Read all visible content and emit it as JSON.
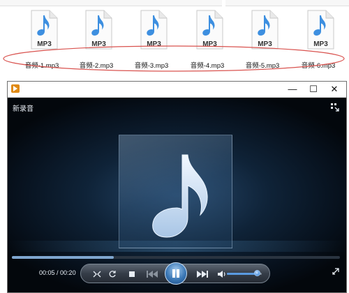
{
  "explorer": {
    "files": [
      {
        "icon": "mp3-file-icon",
        "badge": "MP3",
        "name": "音频-1.mp3"
      },
      {
        "icon": "mp3-file-icon",
        "badge": "MP3",
        "name": "音频-2.mp3"
      },
      {
        "icon": "mp3-file-icon",
        "badge": "MP3",
        "name": "音频-3.mp3"
      },
      {
        "icon": "mp3-file-icon",
        "badge": "MP3",
        "name": "音频-4.mp3"
      },
      {
        "icon": "mp3-file-icon",
        "badge": "MP3",
        "name": "音频-5.mp3"
      },
      {
        "icon": "mp3-file-icon",
        "badge": "MP3",
        "name": "音频-6.mp3"
      }
    ],
    "selection_color": "#d9534f"
  },
  "player": {
    "window": {
      "minimize": "—",
      "maximize": "☐",
      "close": "✕"
    },
    "title": "新录音",
    "time": {
      "current": "00:05",
      "separator": " / ",
      "total": "00:20"
    },
    "progress": 0.31,
    "volume": 0.85,
    "icons": {
      "shuffle": "shuffle-icon",
      "repeat": "repeat-icon",
      "stop": "stop-icon",
      "previous": "previous-icon",
      "pause": "pause-icon",
      "next": "next-icon",
      "volume": "speaker-icon",
      "switch": "switch-to-library-icon",
      "fullscreen": "fullscreen-icon",
      "album_art": "music-note-icon"
    },
    "colors": {
      "accent": "#3b78b6",
      "background": "#050a12",
      "note": "#d9e8f6"
    }
  }
}
